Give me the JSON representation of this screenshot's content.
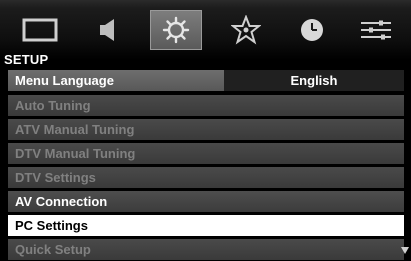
{
  "menu": {
    "tabs": [
      {
        "icon": "picture-icon"
      },
      {
        "icon": "sound-icon"
      },
      {
        "icon": "setup-icon",
        "active": true
      },
      {
        "icon": "preferences-icon"
      },
      {
        "icon": "timer-icon"
      },
      {
        "icon": "options-icon"
      }
    ],
    "title": "SETUP",
    "language": {
      "label": "Menu Language",
      "value": "English"
    },
    "items": [
      {
        "label": "Auto Tuning",
        "state": "disabled"
      },
      {
        "label": "ATV Manual Tuning",
        "state": "disabled"
      },
      {
        "label": "DTV Manual Tuning",
        "state": "disabled"
      },
      {
        "label": "DTV Settings",
        "state": "disabled"
      },
      {
        "label": "AV Connection",
        "state": "enabled"
      },
      {
        "label": "PC Settings",
        "state": "selected"
      },
      {
        "label": "Quick Setup",
        "state": "disabled"
      }
    ],
    "colors": {
      "row": "#3f3f3f",
      "selected": "#ffffff",
      "disabled_text": "#808080"
    }
  }
}
